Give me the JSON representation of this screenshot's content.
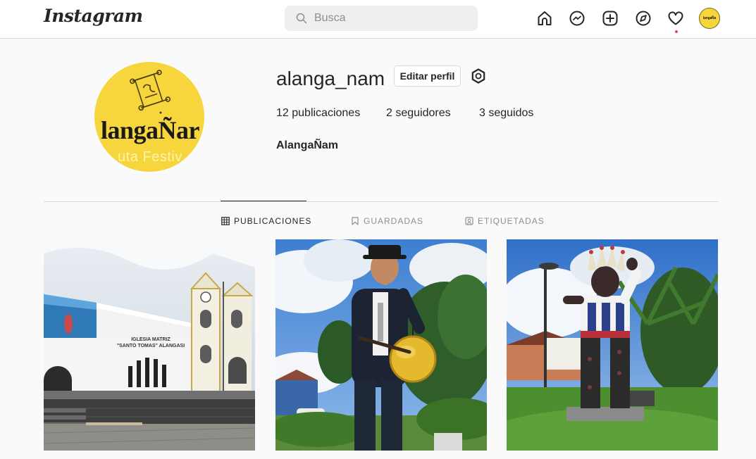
{
  "navbar": {
    "logo": "Instagram",
    "search_placeholder": "Busca",
    "avatar_text": "langaÑa",
    "icons": [
      "home-icon",
      "messenger-icon",
      "new-post-icon",
      "explore-icon",
      "activity-heart-icon",
      "profile-avatar"
    ]
  },
  "profile": {
    "avatar_text": "langaÑar",
    "avatar_subtext": "uta Festiv",
    "username": "alanga_nam",
    "edit_button": "Editar perfil",
    "stats": {
      "posts_count": "12",
      "posts_label": " publicaciones",
      "followers_count": "2",
      "followers_label": " seguidores",
      "following_count": "3",
      "following_label": " seguidos"
    },
    "full_name": "AlangaÑam"
  },
  "tabs": [
    {
      "label": "PUBLICACIONES",
      "icon": "grid-icon",
      "active": true
    },
    {
      "label": "GUARDADAS",
      "icon": "bookmark-icon",
      "active": false
    },
    {
      "label": "ETIQUETADAS",
      "icon": "tagged-icon",
      "active": false
    }
  ],
  "posts": {
    "post1": {
      "church_sign_line1": "IGLESIA MATRIZ",
      "church_sign_line2": "\"SANTO TOMAS\" ALANGASI"
    }
  },
  "colors": {
    "accent_yellow": "#f6d53d",
    "border": "#dbdbdb",
    "text": "#262626",
    "muted": "#8e8e8e",
    "notification": "#ed4956"
  }
}
